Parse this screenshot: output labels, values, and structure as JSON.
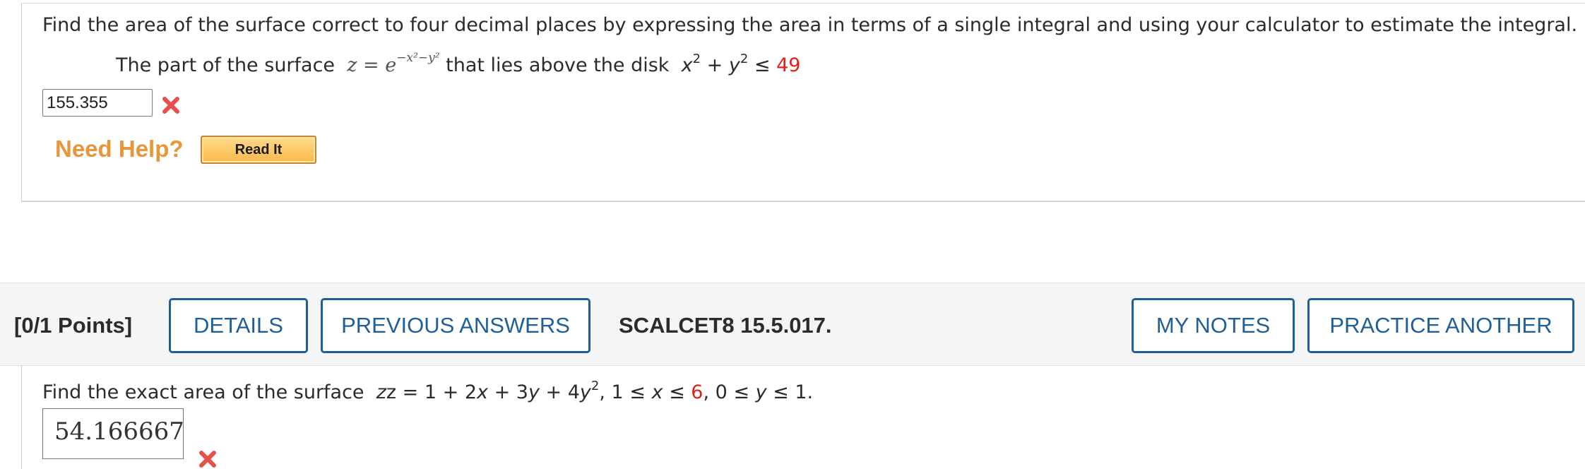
{
  "question1": {
    "instruction": "Find the area of the surface correct to four decimal places by expressing the area in terms of a single integral and using your calculator to estimate the integral.",
    "problem_prefix": "The part of the surface",
    "surface_lhs": "z = e",
    "surface_exponent": "−x²−y²",
    "problem_middle": "that lies above the disk",
    "disk_x": "x",
    "disk_y": "y",
    "exp2": "2",
    "plus": "+",
    "leq": "≤",
    "disk_radius_sq": "49",
    "answer_value": "155.355",
    "answer_status": "incorrect-icon",
    "need_help": "Need Help?",
    "read_it": "Read It"
  },
  "header": {
    "points": "[0/1 Points]",
    "details": "DETAILS",
    "previous_answers": "PREVIOUS ANSWERS",
    "course_code": "SCALCET8 15.5.017.",
    "my_notes": "MY NOTES",
    "practice_another": "PRACTICE ANOTHER"
  },
  "question2": {
    "prefix": "Find the exact area of the surface",
    "eq_start": "z = 1 + 2",
    "x": "x",
    "plus3": " + 3",
    "y": "y",
    "plus4": " + 4",
    "exp2": "2",
    "range_x_start": ", 1 ≤ ",
    "range_x_mid": " ≤ ",
    "x_upper": "6",
    "range_y_start": ", 0 ≤ ",
    "range_y_end": " ≤ 1.",
    "answer_value": "54.166667",
    "answer_status": "incorrect-icon"
  },
  "colors": {
    "link_blue": "#1f5f98",
    "error_red": "#e0201b",
    "help_orange": "#e8963a",
    "header_bg": "#f5f5f5"
  }
}
